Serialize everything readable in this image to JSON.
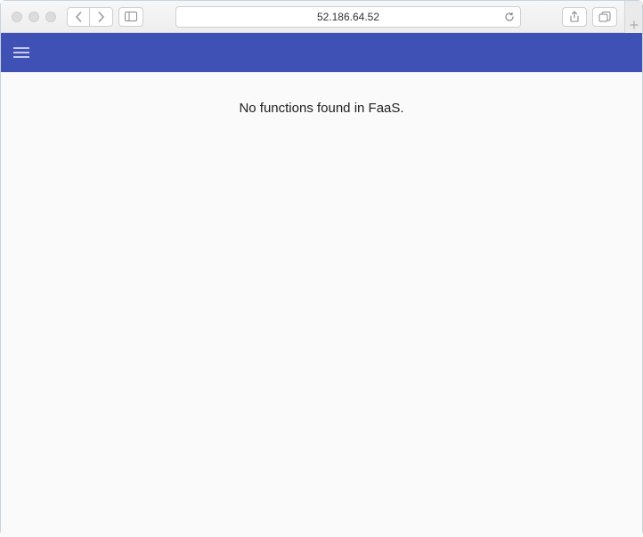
{
  "browser": {
    "address": "52.186.64.52"
  },
  "app": {
    "message": "No functions found in FaaS."
  }
}
